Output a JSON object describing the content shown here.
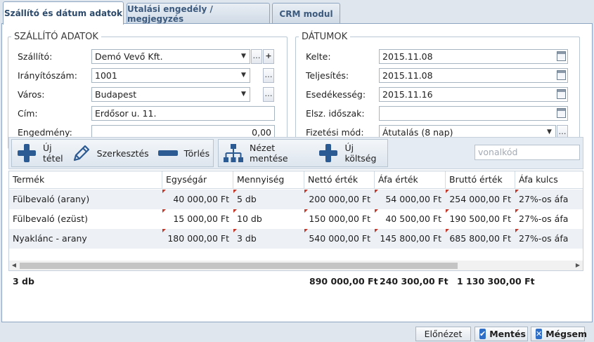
{
  "tabs": [
    {
      "label": "Szállító és dátum adatok",
      "active": true
    },
    {
      "label": "Utalási engedély / megjegyzés",
      "active": false
    },
    {
      "label": "CRM modul",
      "active": false
    }
  ],
  "supplier": {
    "legend": "SZÁLLÍTÓ ADATOK",
    "szallito_label": "Szállító:",
    "szallito_value": "Demó Vevő Kft.",
    "irsz_label": "Irányítószám:",
    "irsz_value": "1001",
    "varos_label": "Város:",
    "varos_value": "Budapest",
    "cim_label": "Cím:",
    "cim_value": "Erdősor u. 11.",
    "engedmeny_label": "Engedmény:",
    "engedmeny_value": "0,00"
  },
  "dates": {
    "legend": "DÁTUMOK",
    "kelte_label": "Kelte:",
    "kelte_value": "2015.11.08",
    "teljesites_label": "Teljesítés:",
    "teljesites_value": "2015.11.08",
    "esedekesseg_label": "Esedékesség:",
    "esedekesseg_value": "2015.11.16",
    "elsz_label": "Elsz. időszak:",
    "elsz_value": "",
    "fizmod_label": "Fizetési mód:",
    "fizmod_value": "Átutalás (8 nap)"
  },
  "toolbar": {
    "new_item": "Új tétel",
    "edit": "Szerkesztés",
    "delete": "Törlés",
    "save_view": "Nézet mentése",
    "new_cost": "Új költség",
    "barcode_placeholder": "vonalkód"
  },
  "grid": {
    "headers": [
      "Termék",
      "Egységár",
      "Mennyiség",
      "Nettó érték",
      "Áfa érték",
      "Bruttó érték",
      "Áfa kulcs"
    ],
    "rows": [
      [
        "Fülbevaló (arany)",
        "40 000,00 Ft",
        "5 db",
        "200 000,00 Ft",
        "54 000,00 Ft",
        "254 000,00 Ft",
        "27%-os áfa"
      ],
      [
        "Fülbevaló (ezüst)",
        "15 000,00 Ft",
        "10 db",
        "150 000,00 Ft",
        "40 500,00 Ft",
        "190 500,00 Ft",
        "27%-os áfa"
      ],
      [
        "Nyaklánc - arany",
        "180 000,00 Ft",
        "3 db",
        "540 000,00 Ft",
        "145 800,00 Ft",
        "685 800,00 Ft",
        "27%-os áfa"
      ]
    ]
  },
  "totals": {
    "qty": "3 db",
    "netto": "890 000,00 Ft",
    "afa": "240 300,00 Ft",
    "brutto": "1 130 300,00 Ft"
  },
  "buttons": {
    "preview": "Előnézet",
    "save": "Mentés",
    "cancel": "Mégsem"
  },
  "colors": {
    "accent": "#2f6ec6",
    "marker": "#c0392b"
  }
}
